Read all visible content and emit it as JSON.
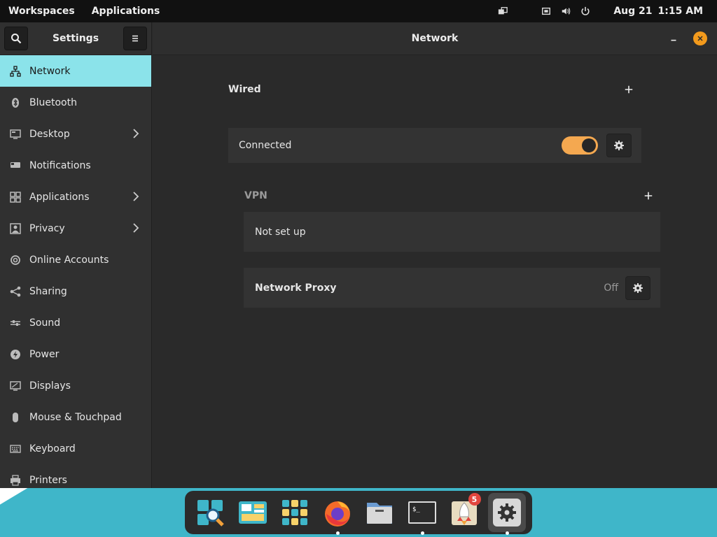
{
  "topbar": {
    "workspaces": "Workspaces",
    "applications": "Applications",
    "date": "Aug 21",
    "time": "1:15 AM",
    "icons": [
      "multitasking-icon",
      "network-icon",
      "volume-icon",
      "power-icon"
    ]
  },
  "sidebar": {
    "title": "Settings",
    "items": [
      {
        "label": "Network",
        "icon": "network-icon",
        "active": true,
        "has_arrow": false
      },
      {
        "label": "Bluetooth",
        "icon": "bluetooth-icon",
        "active": false,
        "has_arrow": false
      },
      {
        "label": "Desktop",
        "icon": "desktop-icon",
        "active": false,
        "has_arrow": true
      },
      {
        "label": "Notifications",
        "icon": "notifications-icon",
        "active": false,
        "has_arrow": false
      },
      {
        "label": "Applications",
        "icon": "applications-icon",
        "active": false,
        "has_arrow": true
      },
      {
        "label": "Privacy",
        "icon": "privacy-icon",
        "active": false,
        "has_arrow": true
      },
      {
        "label": "Online Accounts",
        "icon": "online-accounts-icon",
        "active": false,
        "has_arrow": false
      },
      {
        "label": "Sharing",
        "icon": "sharing-icon",
        "active": false,
        "has_arrow": false
      },
      {
        "label": "Sound",
        "icon": "sound-icon",
        "active": false,
        "has_arrow": false
      },
      {
        "label": "Power",
        "icon": "power-icon",
        "active": false,
        "has_arrow": false
      },
      {
        "label": "Displays",
        "icon": "displays-icon",
        "active": false,
        "has_arrow": false
      },
      {
        "label": "Mouse & Touchpad",
        "icon": "mouse-icon",
        "active": false,
        "has_arrow": false
      },
      {
        "label": "Keyboard",
        "icon": "keyboard-icon",
        "active": false,
        "has_arrow": false
      },
      {
        "label": "Printers",
        "icon": "printers-icon",
        "active": false,
        "has_arrow": false
      }
    ]
  },
  "main": {
    "title": "Network",
    "wired": {
      "heading": "Wired",
      "status": "Connected",
      "toggle_on": true
    },
    "vpn": {
      "heading": "VPN",
      "status": "Not set up"
    },
    "proxy": {
      "label": "Network Proxy",
      "value": "Off"
    }
  },
  "dock": {
    "items": [
      {
        "name": "search-app",
        "running": false
      },
      {
        "name": "workspaces-app",
        "running": false
      },
      {
        "name": "app-grid",
        "running": false
      },
      {
        "name": "firefox",
        "running": true
      },
      {
        "name": "files",
        "running": false
      },
      {
        "name": "terminal",
        "running": true
      },
      {
        "name": "launcher",
        "running": false,
        "badge": "5"
      },
      {
        "name": "settings",
        "running": true,
        "active": true
      }
    ]
  },
  "colors": {
    "accent": "#8be3ea",
    "toggle": "#f4a850",
    "close": "#f39a1c",
    "badge": "#e2463e",
    "wallpaper": "#3fb6c9"
  }
}
